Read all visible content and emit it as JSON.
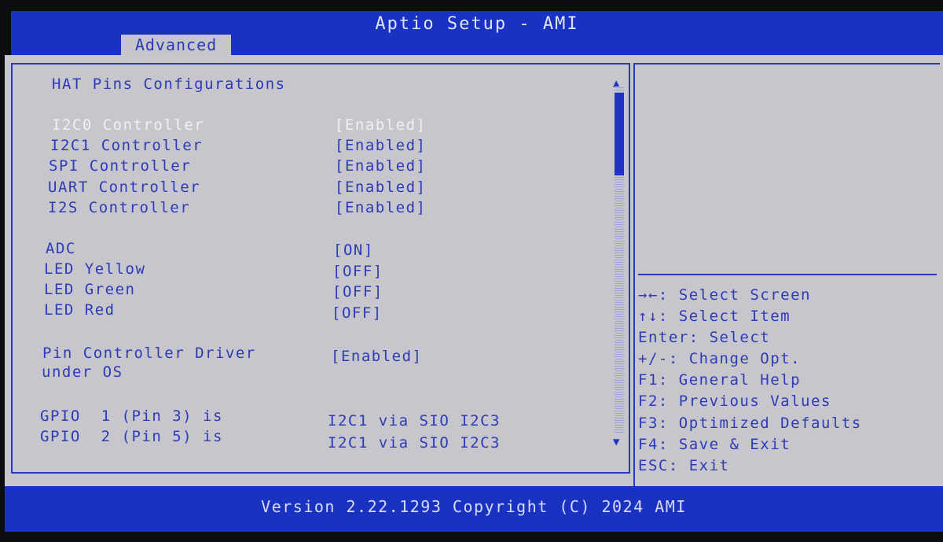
{
  "window": {
    "title": "Aptio Setup - AMI",
    "tabs": [
      {
        "label": "Advanced",
        "active": true
      }
    ]
  },
  "main": {
    "section_title": "HAT Pins Configurations",
    "items": [
      {
        "label": "I2C0 Controller",
        "value": "[Enabled]",
        "highlighted": true
      },
      {
        "label": "I2C1 Controller",
        "value": "[Enabled]"
      },
      {
        "label": "SPI Controller",
        "value": "[Enabled]"
      },
      {
        "label": "UART Controller",
        "value": "[Enabled]"
      },
      {
        "label": "I2S Controller",
        "value": "[Enabled]"
      },
      {
        "label": "ADC",
        "value": "[ON]"
      },
      {
        "label": "LED Yellow",
        "value": "[OFF]"
      },
      {
        "label": "LED Green",
        "value": "[OFF]"
      },
      {
        "label": "LED Red",
        "value": "[OFF]"
      },
      {
        "label": "Pin Controller Driver",
        "label_line2": "under OS",
        "value": "[Enabled]"
      },
      {
        "label": "GPIO  1 (Pin 3) is",
        "value": "I2C1 via SIO I2C3"
      },
      {
        "label": "GPIO  2 (Pin 5) is",
        "value": "I2C1 via SIO I2C3"
      }
    ]
  },
  "help": {
    "keys": [
      "→←: Select Screen",
      "↑↓: Select Item",
      "Enter: Select",
      "+/-: Change Opt.",
      "F1: General Help",
      "F2: Previous Values",
      "F3: Optimized Defaults",
      "F4: Save & Exit",
      "ESC: Exit"
    ]
  },
  "footer": {
    "version": "Version 2.22.1293 Copyright (C) 2024 AMI"
  },
  "icons": {
    "scroll_up": "up-triangle",
    "scroll_down": "down-triangle"
  },
  "colors": {
    "bar_blue": "#1a32c2",
    "panel_gray": "#c6c6cc",
    "text_blue": "#2d3bb6",
    "highlight_white": "#f0f0f4"
  }
}
